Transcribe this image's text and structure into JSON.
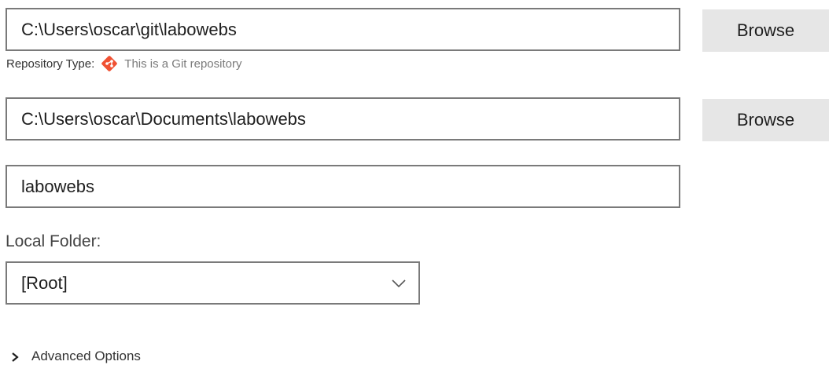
{
  "repository": {
    "path_value": "C:\\Users\\oscar\\git\\labowebs",
    "browse_label": "Browse",
    "type_label": "Repository Type:",
    "type_value": "This is a Git repository",
    "type_icon": "git-icon",
    "git_icon_color": "#f05133"
  },
  "local_path": {
    "value": "C:\\Users\\oscar\\Documents\\labowebs",
    "browse_label": "Browse"
  },
  "name": {
    "value": "labowebs"
  },
  "local_folder": {
    "label": "Local Folder:",
    "selected": "[Root]",
    "icon": "chevron-down-icon"
  },
  "advanced": {
    "label": "Advanced Options",
    "icon": "chevron-right-icon"
  }
}
